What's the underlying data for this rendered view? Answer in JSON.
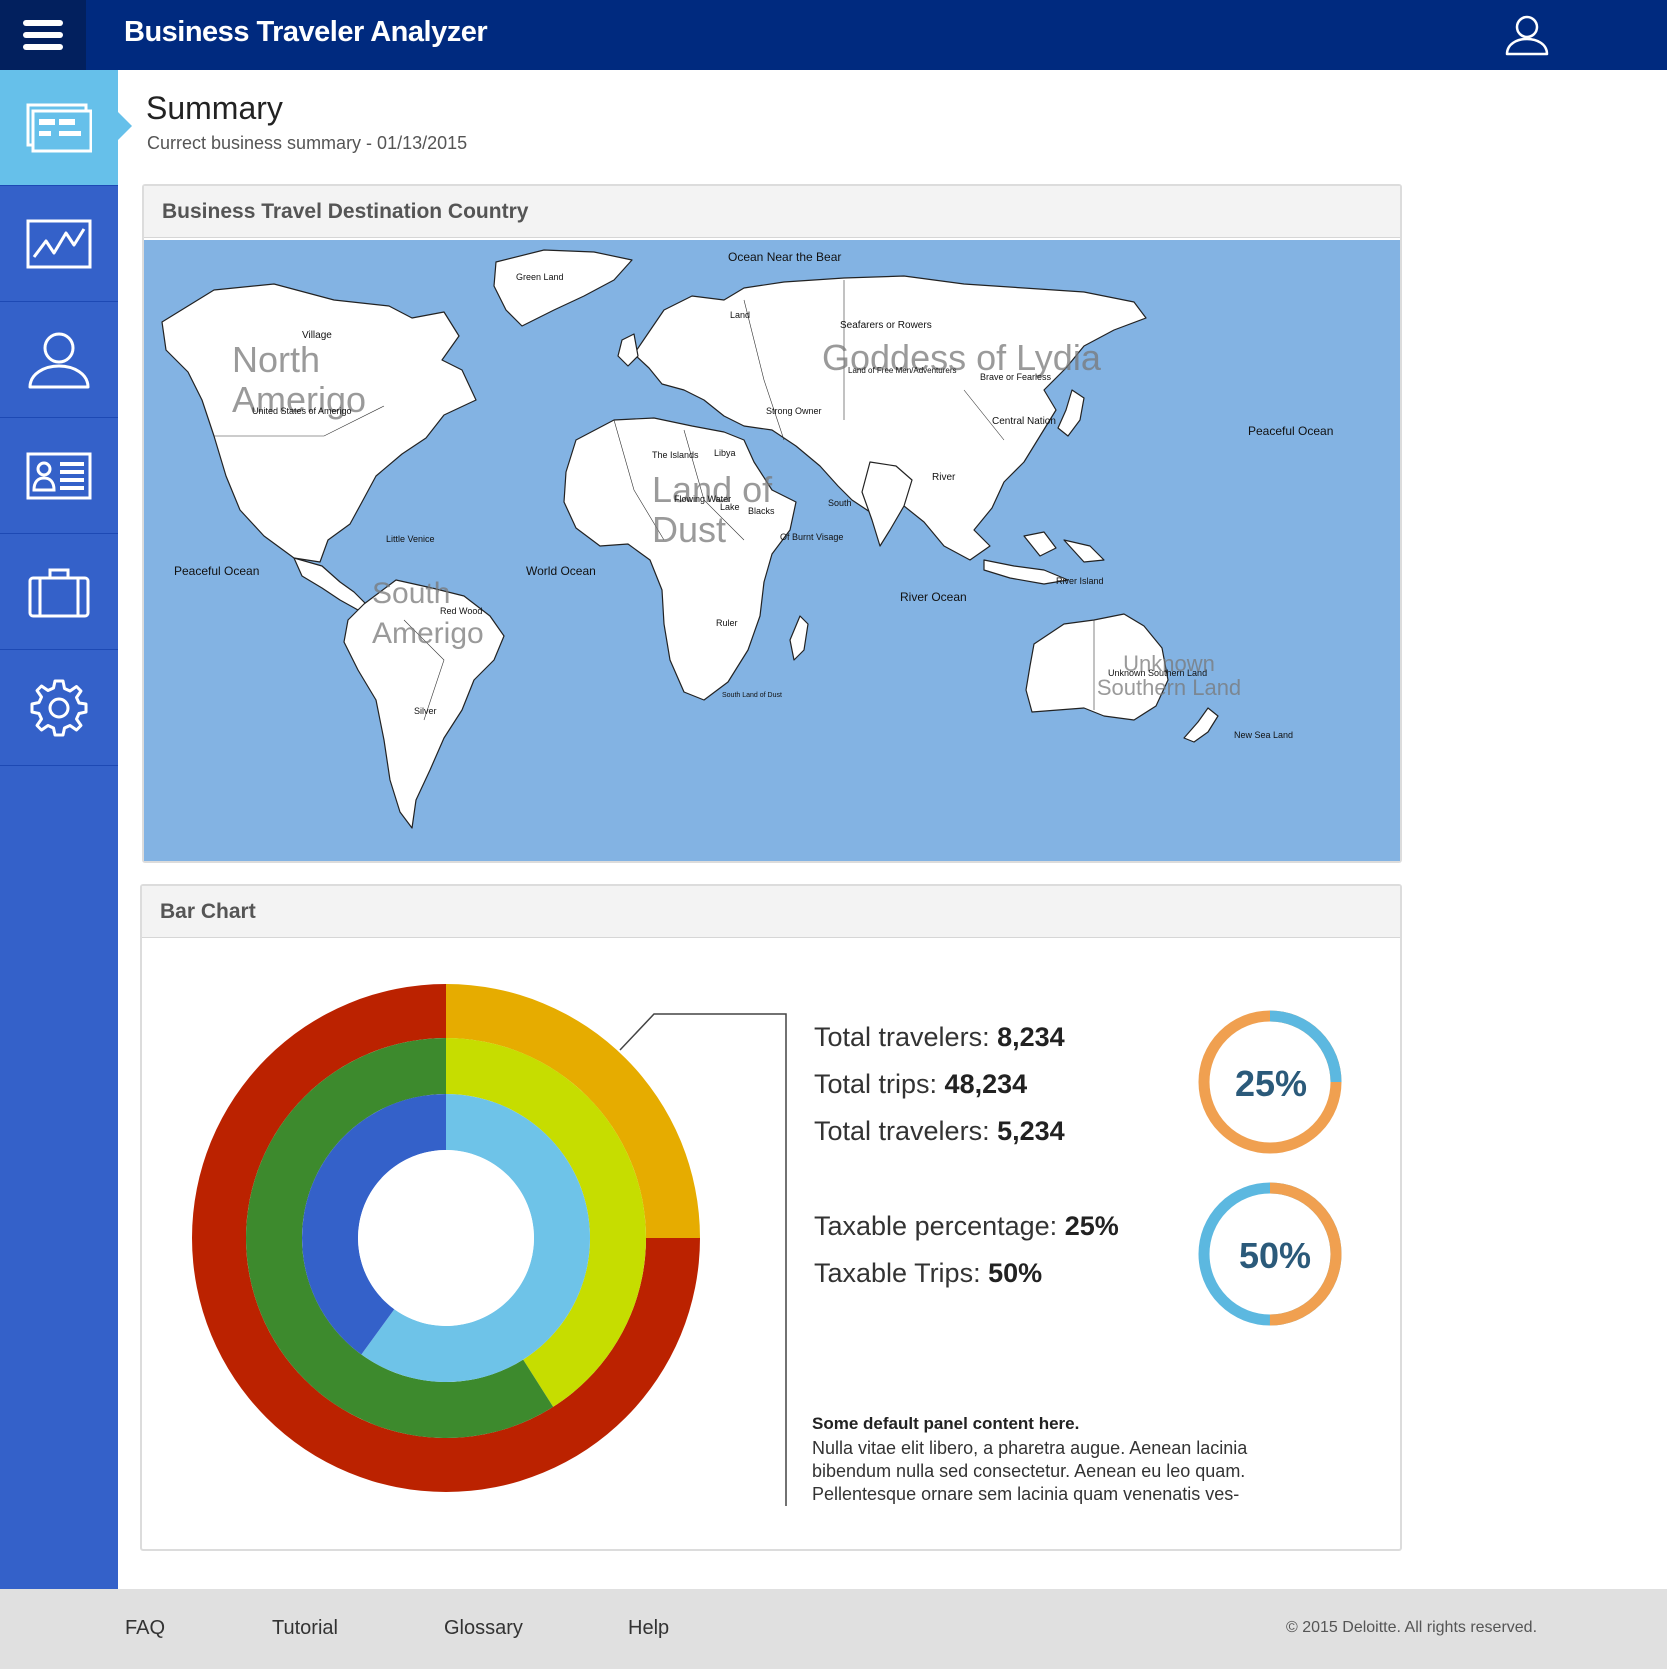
{
  "header": {
    "title": "Business Traveler Analyzer",
    "menu_icon": "hamburger-icon",
    "user_icon": "user-icon"
  },
  "sidebar": {
    "items": [
      {
        "icon": "dashboard-icon",
        "active": true
      },
      {
        "icon": "line-chart-icon",
        "active": false
      },
      {
        "icon": "user-icon",
        "active": false
      },
      {
        "icon": "id-card-icon",
        "active": false
      },
      {
        "icon": "briefcase-icon",
        "active": false
      },
      {
        "icon": "gear-icon",
        "active": false
      }
    ]
  },
  "page": {
    "title": "Summary",
    "subtitle": "Currect business summary - 01/13/2015"
  },
  "map_panel": {
    "title": "Business Travel Destination Country",
    "labels": {
      "green_land": "Green Land",
      "ocean_near_bear": "Ocean Near the Bear",
      "seafarers": "Seafarers or Rowers",
      "village": "Village",
      "north_amerigo": "North Amerigo",
      "united_states": "United States of Amerigo",
      "goddess_lydia": "Goddess of Lydia",
      "land_free_men": "Land of Free Men/Adventurers",
      "brave_fearless": "Brave or Fearless",
      "central_nation": "Central Nation",
      "peaceful_ocean_east": "Peaceful Ocean",
      "peaceful_ocean_west": "Peaceful Ocean",
      "world_ocean": "World Ocean",
      "land_of_dust": "Land of Dust",
      "strong_owner": "Strong Owner",
      "libya": "Libya",
      "the_islands": "The Islands",
      "flowing_water": "Flowing Water",
      "lake": "Lake",
      "blacks": "Blacks",
      "of_burnt_visage": "Of Burnt Visage",
      "south": "South",
      "river": "River",
      "river_ocean": "River Ocean",
      "south_amerigo": "South Amerigo",
      "red_wood": "Red Wood",
      "little_venice": "Little Venice",
      "silver": "Silver",
      "ruler": "Ruler",
      "south_land_dust": "South Land of Dust",
      "unknown_southern": "Unknown Southern Land",
      "unknown_small": "Unknown Southern Land",
      "new_sea_land": "New Sea Land",
      "land": "Land",
      "river_island": "River Island"
    }
  },
  "chart_panel": {
    "title": "Bar Chart"
  },
  "chart_data": {
    "type": "pie",
    "rings": [
      {
        "name": "",
        "slices": [
          {
            "value": 25,
            "color": "#e6ac00"
          },
          {
            "value": 75,
            "color": "#bb2200"
          }
        ]
      },
      {
        "name": "",
        "slices": [
          {
            "value": 41,
            "color": "#c6dd00"
          },
          {
            "value": 59,
            "color": "#3d8a2d"
          }
        ]
      },
      {
        "name": "",
        "slices": [
          {
            "value": 60,
            "color": "#6ec3e8"
          },
          {
            "value": 40,
            "color": "#3461c9"
          }
        ]
      }
    ]
  },
  "stats": {
    "total_travelers_label": "Total travelers: ",
    "total_travelers_value": "8,234",
    "total_trips_label": "Total trips: ",
    "total_trips_value": "48,234",
    "total_travelers2_label": "Total travelers: ",
    "total_travelers2_value": "5,234",
    "taxable_pct_label": "Taxable percentage: ",
    "taxable_pct_value": "25%",
    "taxable_trips_label": "Taxable Trips: ",
    "taxable_trips_value": "50%"
  },
  "rings": [
    {
      "text": "25%",
      "value": 25,
      "highlight": "#5cb8e0",
      "base": "#f0a050"
    },
    {
      "text": "50%",
      "value": 50,
      "highlight": "#f0a050",
      "base": "#5cb8e0"
    }
  ],
  "note": {
    "title": "Some default panel content here.",
    "text": "Nulla vitae elit libero, a pharetra augue. Aenean lacinia bibendum nulla sed consectetur. Aenean eu leo quam. Pellentesque ornare sem lacinia quam venenatis ves-"
  },
  "footer": {
    "links": [
      "FAQ",
      "Tutorial",
      "Glossary",
      "Help"
    ],
    "copyright": "© 2015 Deloitte. All rights reserved."
  },
  "colors": {
    "header": "#002a7f",
    "sidebar": "#3461c9",
    "sidebar_active": "#66c0ea",
    "map_ocean": "#83b3e3"
  }
}
